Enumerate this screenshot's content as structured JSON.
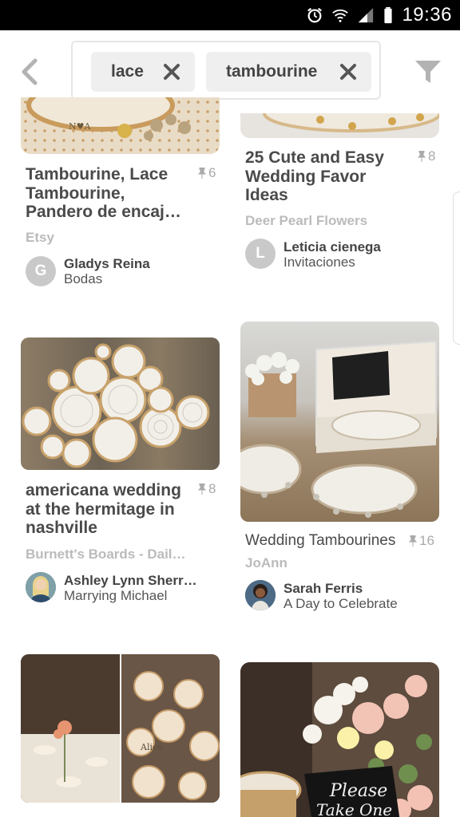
{
  "status_bar": {
    "time": "19:36"
  },
  "search": {
    "chips": [
      {
        "label": "lace"
      },
      {
        "label": "tambourine"
      }
    ]
  },
  "pins": [
    {
      "title": "Tambourine, Lace Tambourine, Pandero de encaj…",
      "saves": "6",
      "source": "Etsy",
      "user": "Gladys Reina",
      "board": "Bodas",
      "avatar_letter": "G"
    },
    {
      "title": "25 Cute and Easy Wedding Favor Ideas",
      "saves": "8",
      "source": "Deer Pearl Flowers",
      "user": "Leticia cienega",
      "board": "Invitaciones",
      "avatar_letter": "L"
    },
    {
      "title": "americana wedding at the hermitage in nashville",
      "saves": "8",
      "source": "Burnett's Boards - Dail…",
      "user": "Ashley Lynn Sherr…",
      "board": "Marrying Michael"
    },
    {
      "title": "Wedding Tambourines",
      "saves": "16",
      "source": "JoAnn",
      "user": "Sarah Ferris",
      "board": "A Day to Celebrate"
    }
  ],
  "image_text": {
    "sign_line1": "Please",
    "sign_line2": "Take One"
  }
}
